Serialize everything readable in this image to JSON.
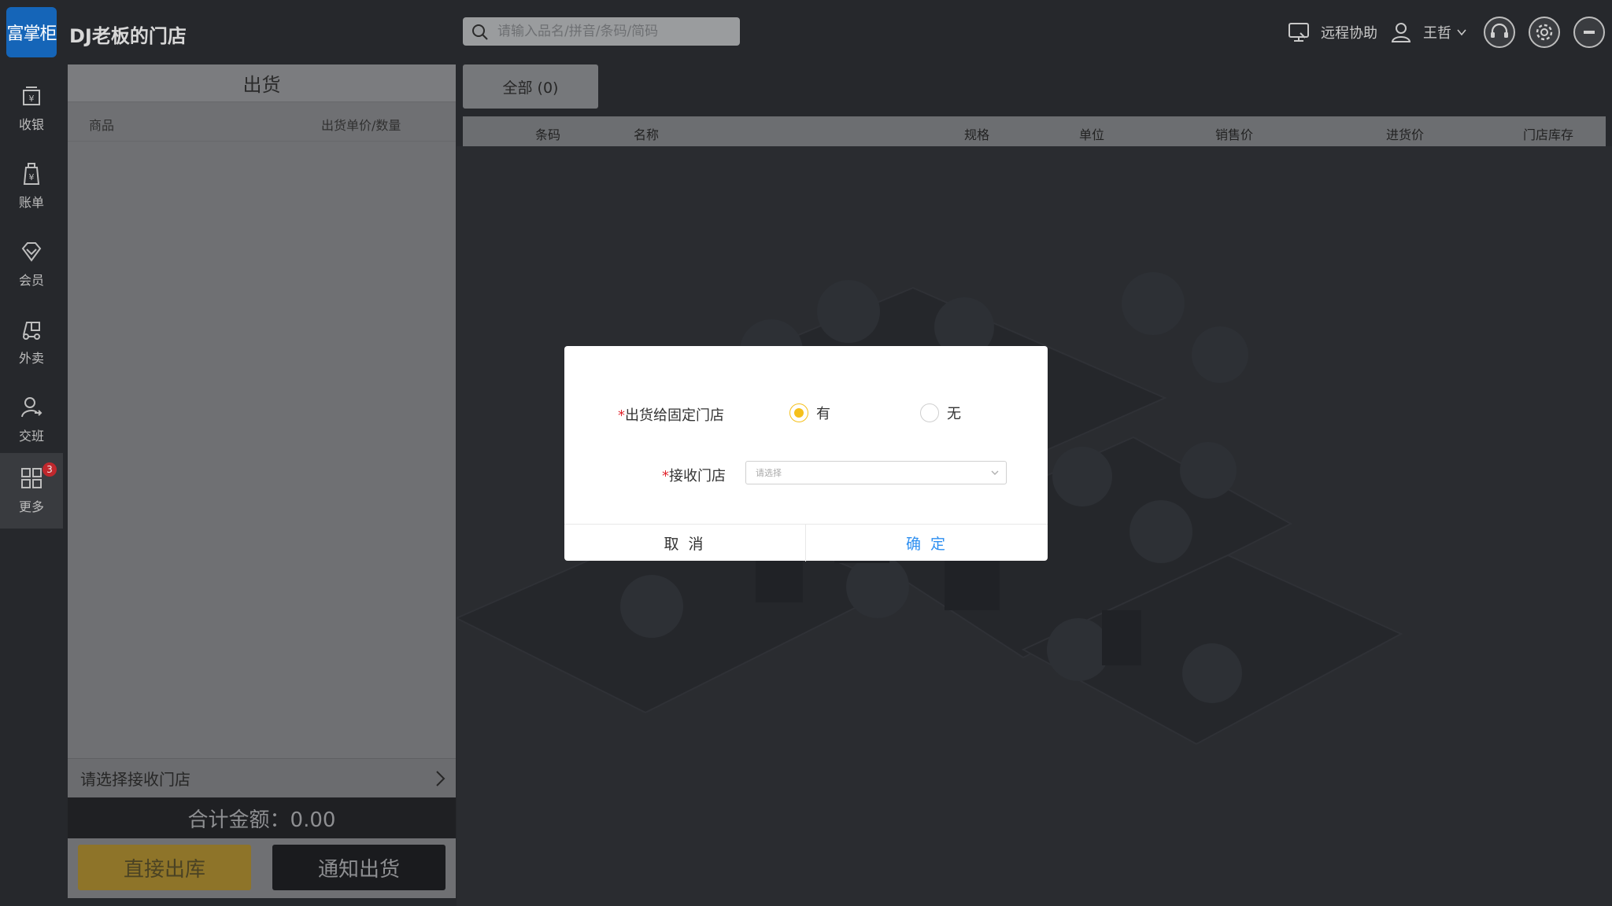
{
  "app": {
    "logo_text": "富掌柜",
    "store_title": "DJ老板的门店"
  },
  "search": {
    "placeholder": "请输入品名/拼音/条码/简码"
  },
  "topbar": {
    "remote_label": "远程协助",
    "user_name": "王哲"
  },
  "sidebar": {
    "items": [
      {
        "label": "收银",
        "icon": "cash-register-icon"
      },
      {
        "label": "账单",
        "icon": "bill-icon"
      },
      {
        "label": "会员",
        "icon": "diamond-icon"
      },
      {
        "label": "外卖",
        "icon": "delivery-icon"
      },
      {
        "label": "交班",
        "icon": "shift-user-icon"
      },
      {
        "label": "更多",
        "icon": "grid-icon",
        "badge": "3"
      }
    ]
  },
  "panel": {
    "title": "出货",
    "col_product": "商品",
    "col_price_qty": "出货单价/数量",
    "receive_store": "请选择接收门店",
    "total": "合计金额：0.00",
    "btn_direct": "直接出库",
    "btn_notify": "通知出货"
  },
  "tab": {
    "all": "全部 (0)"
  },
  "table": {
    "headers": [
      "条码",
      "名称",
      "规格",
      "单位",
      "销售价",
      "进货价",
      "门店库存"
    ]
  },
  "modal": {
    "field1_label": "出货给固定门店",
    "option_yes": "有",
    "option_no": "无",
    "selected": "有",
    "field2_label": "接收门店",
    "select_placeholder": "请选择",
    "cancel": "取 消",
    "confirm": "确 定"
  },
  "colors": {
    "accent_yellow": "#f5c01a",
    "confirm_blue": "#2e8ff0",
    "required_red": "#e0262e",
    "logo_blue": "#1565b8"
  }
}
